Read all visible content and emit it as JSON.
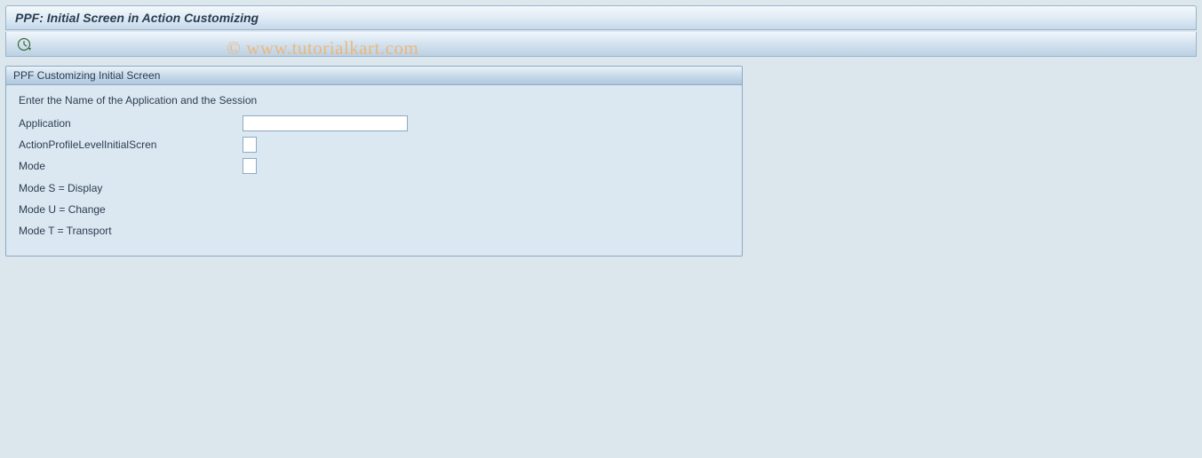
{
  "title": "PPF: Initial Screen in Action Customizing",
  "watermark": "© www.tutorialkart.com",
  "panel": {
    "header": "PPF Customizing Initial Screen",
    "instruction": "Enter the Name of the Application and the Session",
    "fields": {
      "application": {
        "label": "Application",
        "value": ""
      },
      "actionProfile": {
        "label": "ActionProfileLevelInitialScren",
        "value": ""
      },
      "mode": {
        "label": "Mode",
        "value": ""
      }
    },
    "help": {
      "line1": "Mode S = Display",
      "line2": "Mode U = Change",
      "line3": "Mode T = Transport"
    }
  }
}
